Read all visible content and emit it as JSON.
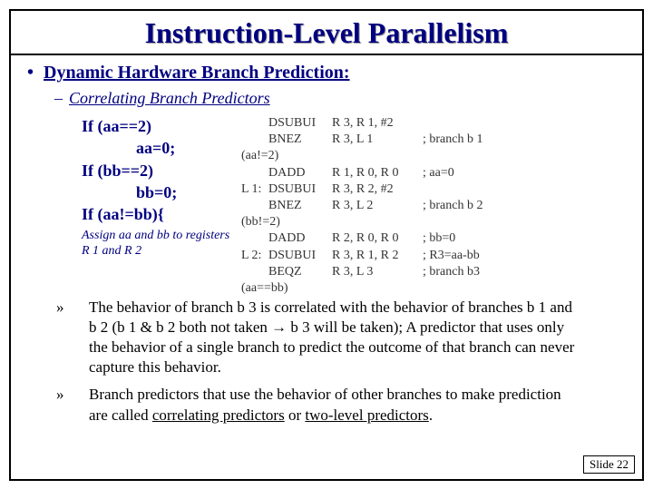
{
  "title": "Instruction-Level Parallelism",
  "bullet1": "Dynamic Hardware Branch Prediction:",
  "bullet2": "Correlating Branch Predictors",
  "code": {
    "l1": "If (aa==2)",
    "l2": "aa=0;",
    "l3": "If (bb==2)",
    "l4": "bb=0;",
    "l5": "If (aa!=bb){"
  },
  "assign_note": "Assign aa and bb to registers R 1 and R 2",
  "asm": {
    "r1": {
      "lab": "",
      "op": "DSUBUI",
      "args": "R 3, R 1, #2",
      "cmt": ""
    },
    "r2": {
      "lab": "",
      "op": "BNEZ",
      "args": "R 3, L 1",
      "cmt": "; branch b 1"
    },
    "r2b": "(aa!=2)",
    "r3": {
      "lab": "",
      "op": "DADD",
      "args": "R 1, R 0, R 0",
      "cmt": "; aa=0"
    },
    "r4": {
      "lab": "L 1:",
      "op": "DSUBUI",
      "args": "R 3, R 2, #2",
      "cmt": ""
    },
    "r5": {
      "lab": "",
      "op": "BNEZ",
      "args": "R 3, L 2",
      "cmt": "; branch b 2"
    },
    "r5b": "(bb!=2)",
    "r6": {
      "lab": "",
      "op": "DADD",
      "args": "R 2, R 0, R 0",
      "cmt": "; bb=0"
    },
    "r7": {
      "lab": "L 2:",
      "op": "DSUBUI",
      "args": "R 3, R 1, R 2",
      "cmt": "; R3=aa-bb"
    },
    "r8": {
      "lab": "",
      "op": "BEQZ",
      "args": "R 3, L 3",
      "cmt": "; branch b3"
    },
    "r8b": "(aa==bb)"
  },
  "body_p1": "The behavior of branch b 3 is correlated with the behavior of branches b 1 and b 2 (b 1 & b 2 both not taken → b 3 will be taken); A predictor that uses only the behavior of a single branch to predict the outcome of that branch can never capture this behavior.",
  "body_p2_pre": "Branch predictors that use the behavior of other branches to make prediction are called ",
  "body_p2_u1": "correlating predictors",
  "body_p2_mid": " or ",
  "body_p2_u2": "two-level predictors",
  "body_p2_post": ".",
  "slide_num": "Slide 22"
}
